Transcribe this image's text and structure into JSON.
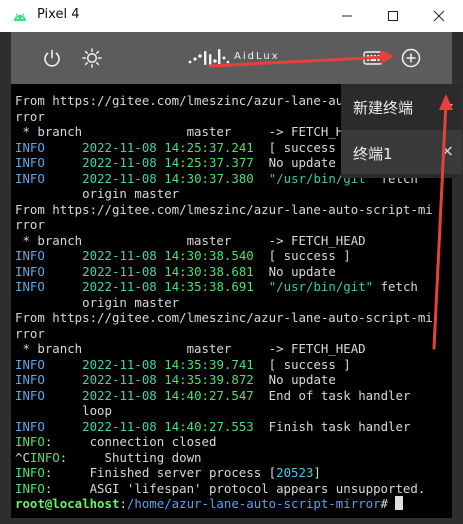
{
  "window": {
    "title": "Pixel 4",
    "min_icon": "minimize-icon",
    "max_icon": "maximize-icon",
    "close_icon": "close-icon"
  },
  "toolbar": {
    "icons": [
      "power-icon",
      "brightness-icon",
      "keyboard-icon",
      "add-circle-icon"
    ],
    "logo_text": "AidLux"
  },
  "menu": {
    "items": [
      {
        "label": "新建终端",
        "action": "+"
      },
      {
        "label": "终端1",
        "action": "×"
      }
    ]
  },
  "terminal": {
    "lines": [
      [
        {
          "t": "From https://gitee.com/lmeszinc/azur-lane-auto-script-mi",
          "c": "plain"
        }
      ],
      [
        {
          "t": "rror",
          "c": "plain"
        }
      ],
      [
        {
          "t": " * branch              master     -> FETCH_HEAD",
          "c": "plain"
        }
      ],
      [
        {
          "t": "INFO",
          "c": "info"
        },
        {
          "t": "     ",
          "c": "plain"
        },
        {
          "t": "2022-11-08",
          "c": "date"
        },
        {
          "t": " ",
          "c": "plain"
        },
        {
          "t": "14:25:37.241",
          "c": "time"
        },
        {
          "t": "  [ success ]",
          "c": "plain"
        }
      ],
      [
        {
          "t": "INFO",
          "c": "info"
        },
        {
          "t": "     ",
          "c": "plain"
        },
        {
          "t": "2022-11-08",
          "c": "date"
        },
        {
          "t": " ",
          "c": "plain"
        },
        {
          "t": "14:25:37.377",
          "c": "time"
        },
        {
          "t": "  No update",
          "c": "plain"
        }
      ],
      [
        {
          "t": "INFO",
          "c": "info"
        },
        {
          "t": "     ",
          "c": "plain"
        },
        {
          "t": "2022-11-08",
          "c": "date"
        },
        {
          "t": " ",
          "c": "plain"
        },
        {
          "t": "14:30:37.380",
          "c": "time"
        },
        {
          "t": "  ",
          "c": "plain"
        },
        {
          "t": "\"/usr/bin/git\"",
          "c": "str"
        },
        {
          "t": " fetch",
          "c": "plain"
        }
      ],
      [
        {
          "t": "         origin master",
          "c": "plain"
        }
      ],
      [
        {
          "t": "From https://gitee.com/lmeszinc/azur-lane-auto-script-mi",
          "c": "plain"
        }
      ],
      [
        {
          "t": "rror",
          "c": "plain"
        }
      ],
      [
        {
          "t": " * branch              master     -> FETCH_HEAD",
          "c": "plain"
        }
      ],
      [
        {
          "t": "INFO",
          "c": "info"
        },
        {
          "t": "     ",
          "c": "plain"
        },
        {
          "t": "2022-11-08",
          "c": "date"
        },
        {
          "t": " ",
          "c": "plain"
        },
        {
          "t": "14:30:38.540",
          "c": "time"
        },
        {
          "t": "  [ success ]",
          "c": "plain"
        }
      ],
      [
        {
          "t": "INFO",
          "c": "info"
        },
        {
          "t": "     ",
          "c": "plain"
        },
        {
          "t": "2022-11-08",
          "c": "date"
        },
        {
          "t": " ",
          "c": "plain"
        },
        {
          "t": "14:30:38.681",
          "c": "time"
        },
        {
          "t": "  No update",
          "c": "plain"
        }
      ],
      [
        {
          "t": "INFO",
          "c": "info"
        },
        {
          "t": "     ",
          "c": "plain"
        },
        {
          "t": "2022-11-08",
          "c": "date"
        },
        {
          "t": " ",
          "c": "plain"
        },
        {
          "t": "14:35:38.691",
          "c": "time"
        },
        {
          "t": "  ",
          "c": "plain"
        },
        {
          "t": "\"/usr/bin/git\"",
          "c": "str"
        },
        {
          "t": " fetch",
          "c": "plain"
        }
      ],
      [
        {
          "t": "         origin master",
          "c": "plain"
        }
      ],
      [
        {
          "t": "From https://gitee.com/lmeszinc/azur-lane-auto-script-mi",
          "c": "plain"
        }
      ],
      [
        {
          "t": "rror",
          "c": "plain"
        }
      ],
      [
        {
          "t": " * branch              master     -> FETCH_HEAD",
          "c": "plain"
        }
      ],
      [
        {
          "t": "INFO",
          "c": "info"
        },
        {
          "t": "     ",
          "c": "plain"
        },
        {
          "t": "2022-11-08",
          "c": "date"
        },
        {
          "t": " ",
          "c": "plain"
        },
        {
          "t": "14:35:39.741",
          "c": "time"
        },
        {
          "t": "  [ success ]",
          "c": "plain"
        }
      ],
      [
        {
          "t": "INFO",
          "c": "info"
        },
        {
          "t": "     ",
          "c": "plain"
        },
        {
          "t": "2022-11-08",
          "c": "date"
        },
        {
          "t": " ",
          "c": "plain"
        },
        {
          "t": "14:35:39.872",
          "c": "time"
        },
        {
          "t": "  No update",
          "c": "plain"
        }
      ],
      [
        {
          "t": "INFO",
          "c": "info"
        },
        {
          "t": "     ",
          "c": "plain"
        },
        {
          "t": "2022-11-08",
          "c": "date"
        },
        {
          "t": " ",
          "c": "plain"
        },
        {
          "t": "14:40:27.547",
          "c": "time"
        },
        {
          "t": "  End of task handler",
          "c": "plain"
        }
      ],
      [
        {
          "t": "         loop",
          "c": "plain"
        }
      ],
      [
        {
          "t": "INFO",
          "c": "info"
        },
        {
          "t": "     ",
          "c": "plain"
        },
        {
          "t": "2022-11-08",
          "c": "date"
        },
        {
          "t": " ",
          "c": "plain"
        },
        {
          "t": "14:40:27.553",
          "c": "time"
        },
        {
          "t": "  Finish task handler",
          "c": "plain"
        }
      ],
      [
        {
          "t": "INFO",
          "c": "time"
        },
        {
          "t": ":     connection closed",
          "c": "plain"
        }
      ],
      [
        {
          "t": "^C",
          "c": "plain"
        },
        {
          "t": "INFO",
          "c": "time"
        },
        {
          "t": ":     Shutting down",
          "c": "plain"
        }
      ],
      [
        {
          "t": "INFO",
          "c": "time"
        },
        {
          "t": ":     Finished server process [",
          "c": "plain"
        },
        {
          "t": "20523",
          "c": "pid"
        },
        {
          "t": "]",
          "c": "plain"
        }
      ],
      [
        {
          "t": "INFO",
          "c": "time"
        },
        {
          "t": ":     ASGI 'lifespan' protocol appears unsupported.",
          "c": "plain"
        }
      ],
      [
        {
          "t": "root@localhost",
          "c": "host"
        },
        {
          "t": ":",
          "c": "plain"
        },
        {
          "t": "/home/azur-lane-auto-script-mirror",
          "c": "path"
        },
        {
          "t": "# ",
          "c": "plain"
        }
      ]
    ]
  },
  "colors": {
    "annotation_arrow": "#e8403a",
    "android_green": "#3ddc84"
  }
}
